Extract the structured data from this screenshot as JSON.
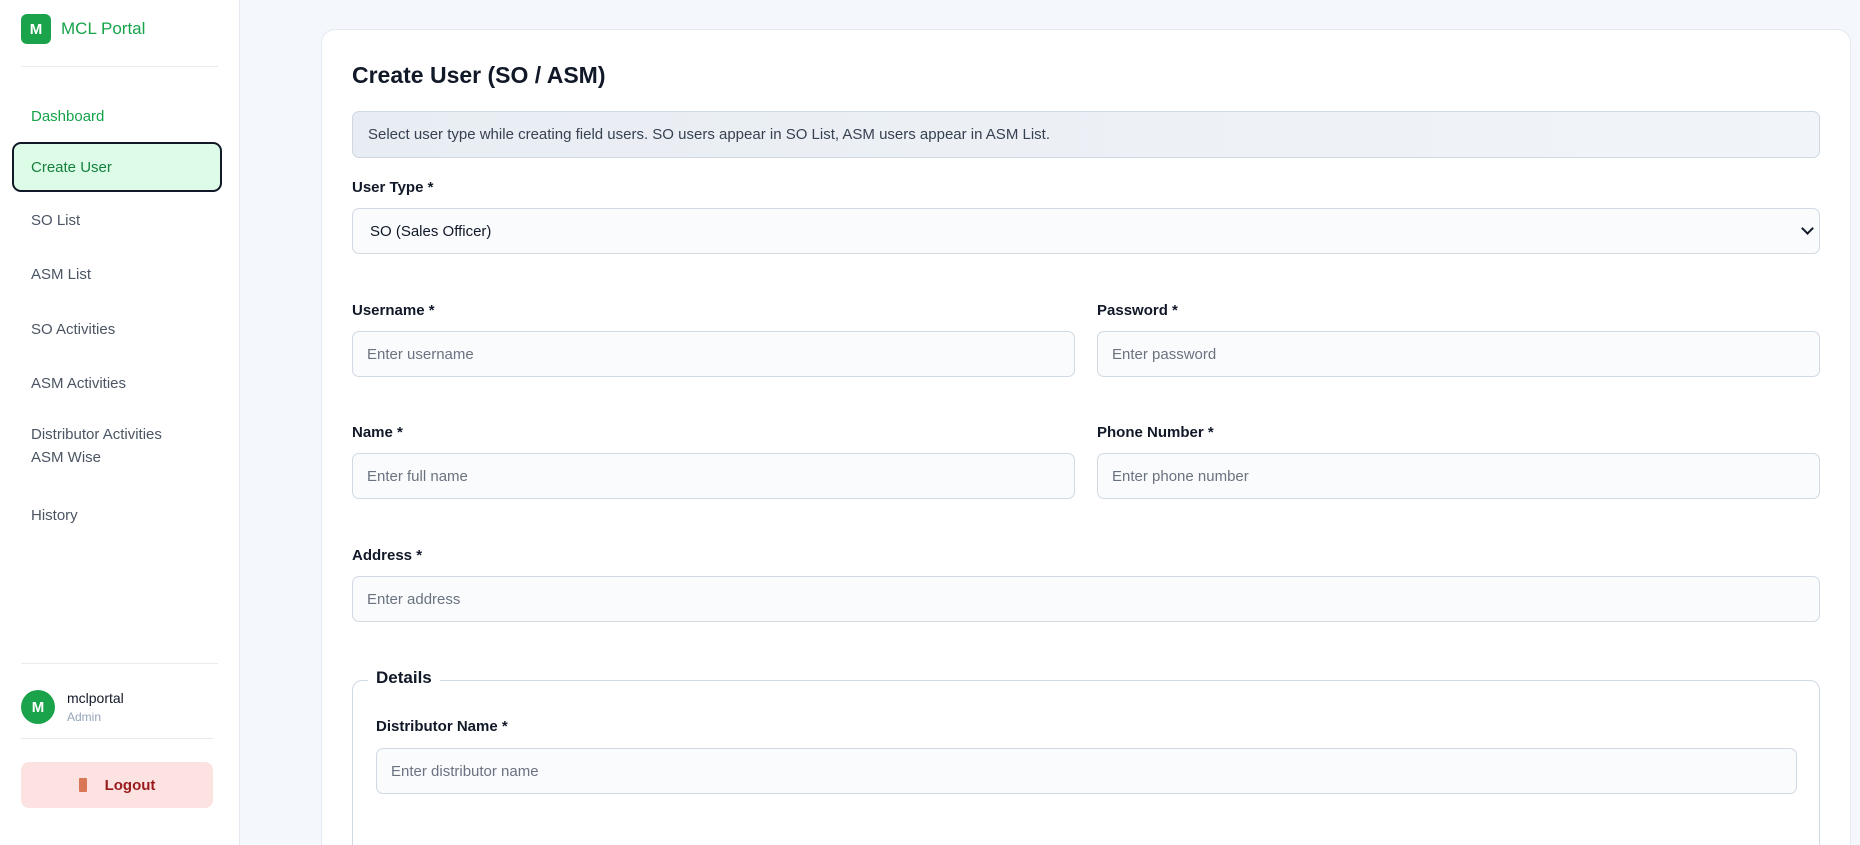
{
  "brand": {
    "logo_letter": "M",
    "name": "MCL Portal",
    "color": "#16a34a"
  },
  "sidebar": {
    "items": [
      {
        "label": "Dashboard"
      },
      {
        "label": "Create User"
      },
      {
        "label": "SO List"
      },
      {
        "label": "ASM List"
      },
      {
        "label": "SO Activities"
      },
      {
        "label": "ASM Activities"
      },
      {
        "label_line1": "Distributor Activities",
        "label_line2": "ASM Wise"
      },
      {
        "label": "History"
      }
    ]
  },
  "user": {
    "initial": "M",
    "name": "mclportal",
    "role": "Admin"
  },
  "logout": {
    "label": "Logout"
  },
  "main": {
    "title": "Create User (SO / ASM)",
    "banner": "Select user type while creating field users. SO users appear in SO List, ASM users appear in ASM List.",
    "user_type": {
      "label": "User Type *",
      "value": "SO (Sales Officer)"
    },
    "username": {
      "label": "Username *",
      "placeholder": "Enter username"
    },
    "password": {
      "label": "Password *",
      "placeholder": "Enter password"
    },
    "name": {
      "label": "Name *",
      "placeholder": "Enter full name"
    },
    "phone": {
      "label": "Phone Number *",
      "placeholder": "Enter phone number"
    },
    "address": {
      "label": "Address *",
      "placeholder": "Enter address"
    },
    "details": {
      "legend": "Details",
      "distributor": {
        "label": "Distributor Name *",
        "placeholder": "Enter distributor name"
      }
    }
  }
}
